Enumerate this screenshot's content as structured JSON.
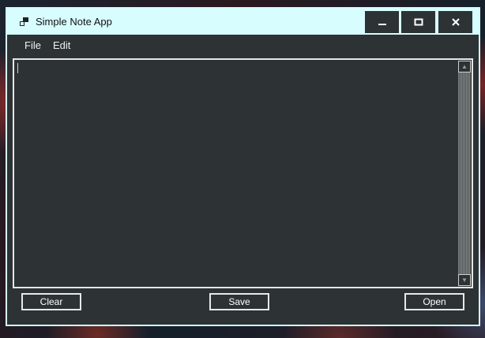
{
  "window": {
    "title": "Simple Note App",
    "minimize_icon": "minimize-icon",
    "maximize_icon": "maximize-icon",
    "close_icon": "close-icon"
  },
  "menu": {
    "items": [
      {
        "label": "File"
      },
      {
        "label": "Edit"
      }
    ]
  },
  "editor": {
    "value": ""
  },
  "buttons": {
    "clear": "Clear",
    "save": "Save",
    "open": "Open"
  },
  "colors": {
    "titlebar": "#d8fdff",
    "window_bg": "#2d3235",
    "border": "#e8e8e8"
  }
}
